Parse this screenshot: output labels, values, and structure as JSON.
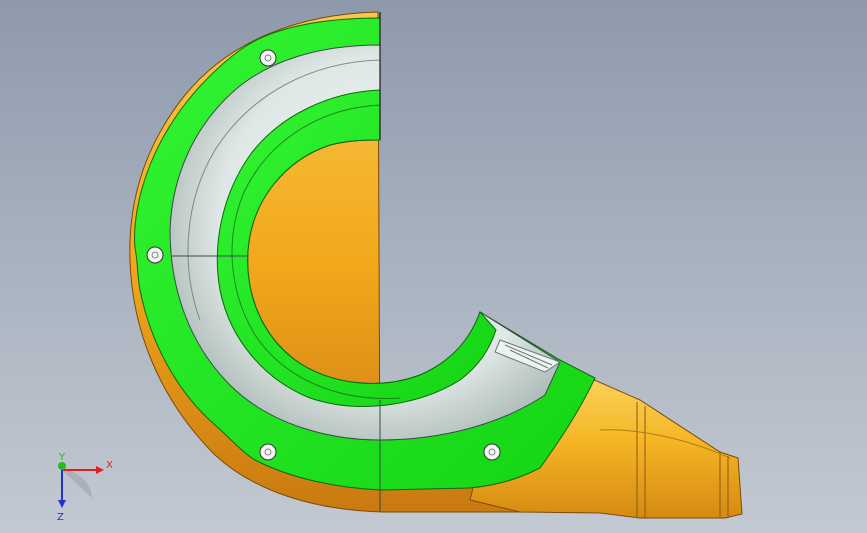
{
  "viewport": {
    "background_top": "#8e99ab",
    "background_bottom": "#c3c9d2"
  },
  "model": {
    "face_highlight_color": "#22ee22",
    "body_color": "#f2a81c",
    "inner_surface_color": "#dfe8e6",
    "bolt_holes": 5
  },
  "triad": {
    "x_label": "X",
    "y_label": "Y",
    "z_label": "Z",
    "x_color": "#e02020",
    "y_color": "#22bb22",
    "z_color": "#2233cc"
  }
}
